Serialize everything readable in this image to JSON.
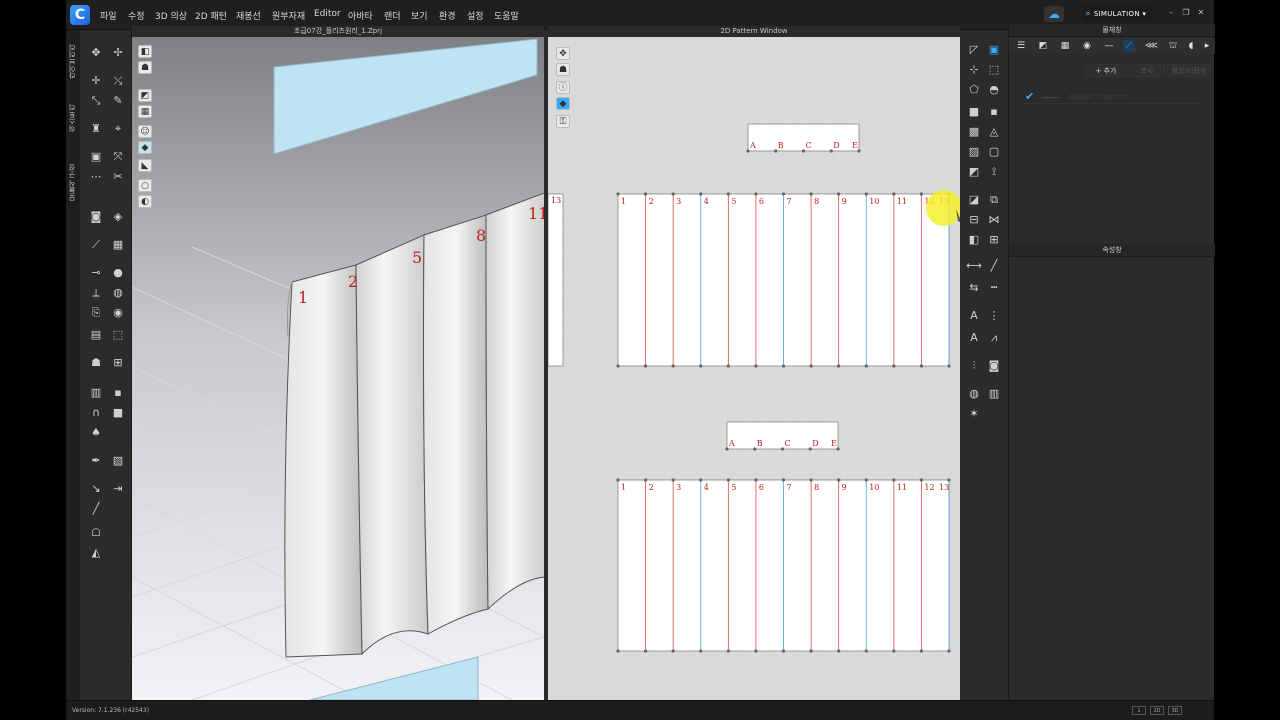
{
  "app": {
    "logo_letter": "C",
    "accent": "#39a9ff"
  },
  "menu": [
    "파일",
    "수정",
    "3D 의상",
    "2D 패턴",
    "재봉선",
    "원부자재",
    "Editor",
    "아바타",
    "랜더",
    "보기",
    "환경",
    "설정",
    "도움말"
  ],
  "simulation_label": "SIMULATION",
  "side_tabs": [
    "라이브러리",
    "히스토리",
    "모듈식 구성"
  ],
  "view3d": {
    "title": "초급07강_플리츠원리_1.Zprj",
    "labels": [
      "1",
      "2",
      "5",
      "8",
      "11"
    ]
  },
  "view2d": {
    "title": "2D Pattern Window",
    "top_band_letters": [
      "A",
      "B",
      "C",
      "D",
      "E"
    ],
    "bottom_band_letters": [
      "A",
      "B",
      "C",
      "D",
      "E"
    ],
    "top_panel_numbers": [
      "1",
      "2",
      "3",
      "4",
      "5",
      "6",
      "7",
      "8",
      "9",
      "10",
      "11",
      "12",
      "13"
    ],
    "bottom_panel_numbers": [
      "1",
      "2",
      "3",
      "4",
      "5",
      "6",
      "7",
      "8",
      "9",
      "10",
      "11",
      "12",
      "13"
    ],
    "left_partial_number": "13"
  },
  "object_panel": {
    "title": "물체창",
    "add_label": "+ 추가",
    "btn2_label": "복사",
    "btn3_label": "활성/비활성",
    "row_dash": "-------",
    "row_name": "Default Topstitch"
  },
  "property_panel": {
    "title": "속성창"
  },
  "status": {
    "version": "Version: 7.1.236 (r42543)",
    "view_buttons": [
      "1",
      "2D",
      "3D"
    ]
  },
  "colors": {
    "fabric_blue": "#bfe3f2",
    "seam_red": "#d84c3a",
    "seam_blue": "#4aa6d8",
    "label_red": "#c0201a"
  }
}
